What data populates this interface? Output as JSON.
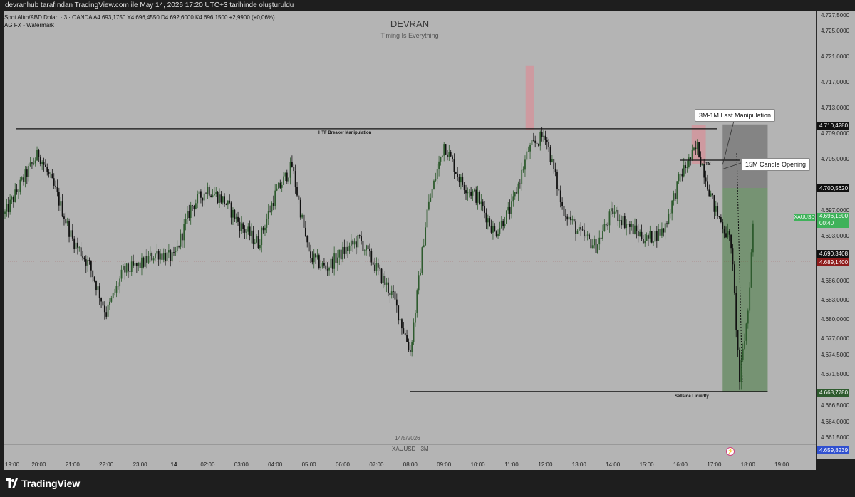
{
  "header": {
    "snapshot_line": "devranhub tarafından TradingView.com ile May 14, 2026 17:20 UTC+3 tarihinde oluşturuldu"
  },
  "symbol": {
    "line1": "Spot Altın/ABD Doları · 3 · OANDA  A4.693,1750  Y4.696,4550  D4.692,6000  K4.696,1500  +2,9900 (+0,06%)",
    "line2": "AG FX - Watermark"
  },
  "watermark": {
    "title": "DEVRAN",
    "subtitle": "Timing Is Everything"
  },
  "annotations": {
    "htf_label": "HTF Breaker Manipulation",
    "sellside_label": "Sellside Liquidty",
    "ts_label": "TS",
    "callout_1": "3M-1M Last Manipulation",
    "callout_2": "15M Candle Opening"
  },
  "price_axis": {
    "ticks": [
      "4.727,5000",
      "4.725,0000",
      "4.721,0000",
      "4.717,0000",
      "4.713,0000",
      "4.709,0000",
      "4.705,0000",
      "4.697,0000",
      "4.693,0000",
      "4.686,0000",
      "4.683,0000",
      "4.680,0000",
      "4.677,0000",
      "4.674,5000",
      "4.671,5000",
      "4.666,5000",
      "4.664,0000",
      "4.661,5000"
    ],
    "labels": {
      "tp_high": "4.710,4280",
      "entry": "4.700,5620",
      "symbol_tag": "XAUUSD",
      "last_price": "4.696,1500",
      "countdown": "00:40",
      "level_1": "4.690,3408",
      "level_2": "4.689,1400",
      "tp_low": "4.668,7780",
      "bottom_line": "4.659,8239"
    }
  },
  "time_axis": {
    "ticks": [
      "19:00",
      "20:00",
      "21:00",
      "22:00",
      "23:00",
      "14",
      "02:00",
      "03:00",
      "04:00",
      "05:00",
      "06:00",
      "07:00",
      "08:00",
      "09:00",
      "10:00",
      "11:00",
      "12:00",
      "13:00",
      "14:00",
      "15:00",
      "16:00",
      "17:00",
      "18:00",
      "19:00"
    ],
    "date_label": "14/5/2026",
    "pane_label": "XAUUSD · 3M"
  },
  "footer": {
    "brand": "TradingView"
  },
  "colors": {
    "plot_bg": "#b4b4b4",
    "candle_up": "#2e5b2e",
    "candle_down": "#111111",
    "green_zone": "#6f8f6b",
    "grey_zone": "#7e7e7e",
    "pink_zone": "#d7929a",
    "blue_line": "#3050d0",
    "last_price_tag": "#3fb25a",
    "level_red": "#8e1b1b",
    "label_black": "#111111"
  },
  "chart_data": {
    "type": "candlestick",
    "symbol": "XAUUSD",
    "timeframe": "3",
    "price_path": [
      [
        "19:00",
        4696.5
      ],
      [
        "19:30",
        4701.5
      ],
      [
        "20:00",
        4706.0
      ],
      [
        "20:30",
        4700.0
      ],
      [
        "21:00",
        4692.5
      ],
      [
        "21:30",
        4688.5
      ],
      [
        "22:00",
        4681.0
      ],
      [
        "22:30",
        4687.5
      ],
      [
        "23:00",
        4688.5
      ],
      [
        "23:30",
        4690.5
      ],
      [
        "00:00",
        4689.5
      ],
      [
        "00:30",
        4697.5
      ],
      [
        "01:00",
        4700.5
      ],
      [
        "01:30",
        4698.5
      ],
      [
        "02:00",
        4694.5
      ],
      [
        "02:30",
        4692.0
      ],
      [
        "03:00",
        4699.5
      ],
      [
        "03:30",
        4704.0
      ],
      [
        "04:00",
        4690.0
      ],
      [
        "04:30",
        4688.0
      ],
      [
        "05:00",
        4690.5
      ],
      [
        "05:30",
        4692.5
      ],
      [
        "06:00",
        4688.0
      ],
      [
        "06:30",
        4683.5
      ],
      [
        "07:00",
        4675.0
      ],
      [
        "07:30",
        4697.0
      ],
      [
        "08:00",
        4707.5
      ],
      [
        "08:30",
        4701.5
      ],
      [
        "09:00",
        4699.0
      ],
      [
        "09:30",
        4693.5
      ],
      [
        "10:00",
        4697.5
      ],
      [
        "10:30",
        4706.5
      ],
      [
        "11:00",
        4709.0
      ],
      [
        "11:30",
        4697.5
      ],
      [
        "12:00",
        4693.5
      ],
      [
        "12:30",
        4691.5
      ],
      [
        "13:00",
        4697.0
      ],
      [
        "13:30",
        4694.5
      ],
      [
        "14:00",
        4692.5
      ],
      [
        "14:30",
        4694.0
      ],
      [
        "15:00",
        4702.5
      ],
      [
        "15:30",
        4707.0
      ],
      [
        "16:00",
        4697.5
      ],
      [
        "16:30",
        4692.0
      ],
      [
        "16:45",
        4670.5
      ],
      [
        "17:00",
        4681.5
      ],
      [
        "17:10",
        4696.2
      ]
    ],
    "levels": {
      "htf_breaker": 4709.8,
      "sellside_liquidity": 4668.8,
      "ts": 4704.9,
      "tp_high": 4710.428,
      "entry": 4700.562,
      "tp_low": 4668.778,
      "bottom_line": 4659.8239,
      "dotted_red": 4689.14
    },
    "zones": [
      {
        "kind": "supply",
        "t0": "10:25",
        "t1": "10:40",
        "p0": 4709.6,
        "p1": 4719.7
      },
      {
        "kind": "supply",
        "t0": "15:20",
        "t1": "15:45",
        "p0": 4704.3,
        "p1": 4710.4
      },
      {
        "kind": "risk",
        "t0": "16:15",
        "t1": "17:35",
        "p0": 4700.562,
        "p1": 4710.428
      },
      {
        "kind": "reward",
        "t0": "16:15",
        "t1": "17:35",
        "p0": 4668.778,
        "p1": 4700.562
      }
    ],
    "y_range": [
      4659.0,
      4729.0
    ],
    "x_range": [
      "18:55",
      "19:50"
    ]
  }
}
